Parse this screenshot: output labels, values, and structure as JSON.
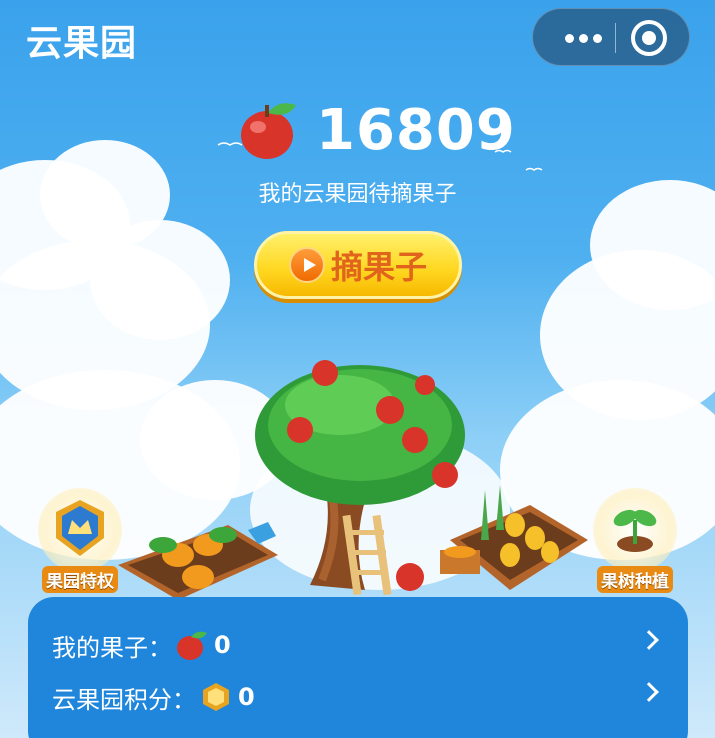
{
  "app": {
    "title": "云果园"
  },
  "capsule": {
    "more_icon": "more-dots-icon",
    "close_icon": "target-close-icon"
  },
  "summary": {
    "count": "16809",
    "subtitle": "我的云果园待摘果子"
  },
  "pick_button": {
    "label": "摘果子",
    "icon": "play-icon"
  },
  "side_badges": [
    {
      "label": "果园特权",
      "icon": "crown-shield-icon"
    },
    {
      "label": "果树种植",
      "icon": "sapling-icon"
    }
  ],
  "panel": {
    "rows": [
      {
        "label": "我的果子：",
        "value": "0",
        "icon": "apple-icon"
      },
      {
        "label": "云果园积分：",
        "value": "0",
        "icon": "coin-icon"
      }
    ]
  },
  "colors": {
    "sky": "#3aa2ec",
    "panel": "#1f86db",
    "button": "#ffd61f",
    "button_text": "#e0641b"
  }
}
